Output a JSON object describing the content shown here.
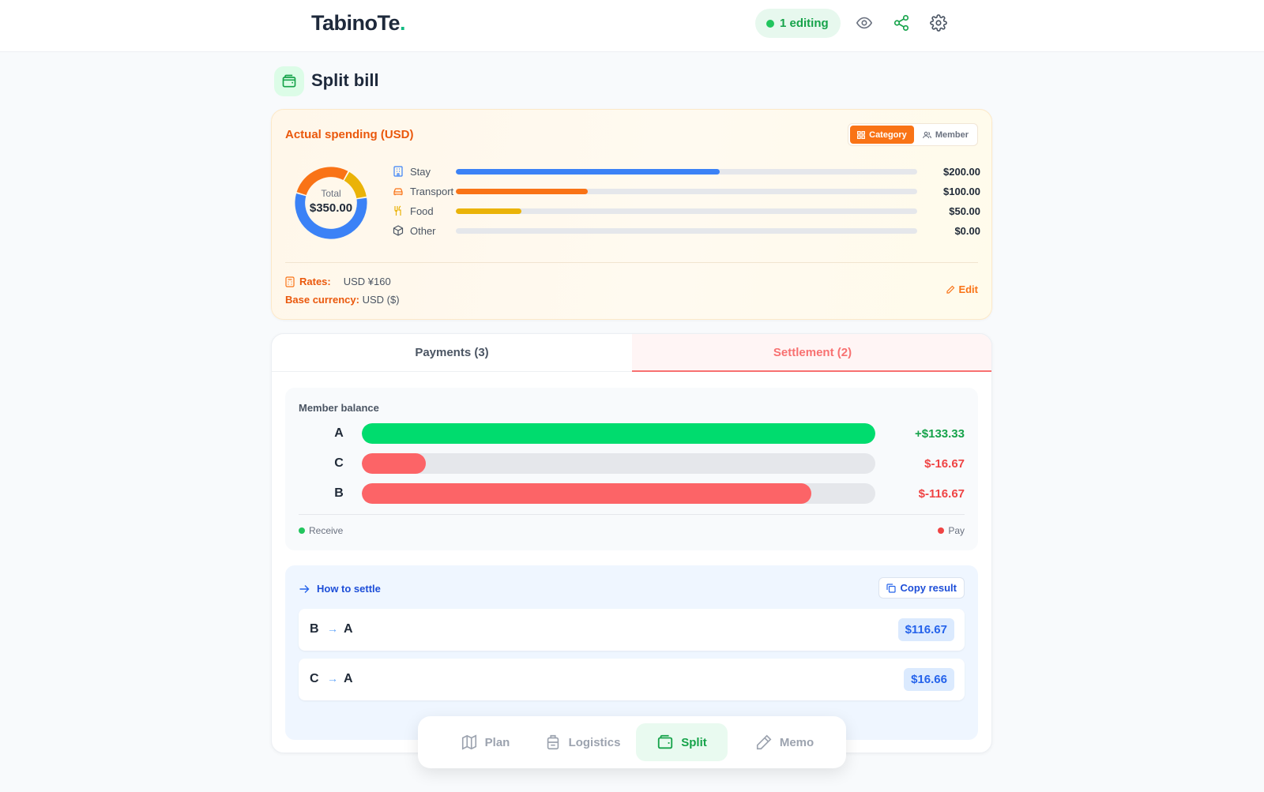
{
  "header": {
    "logo_text": "TabinoTe",
    "logo_dot": ".",
    "editing_label": "1 editing",
    "icons": [
      "eye-icon",
      "share-icon",
      "gear-icon"
    ]
  },
  "page": {
    "title": "Split bill",
    "icon": "wallet-icon"
  },
  "spending": {
    "title": "Actual spending (USD)",
    "toggle": {
      "category_label": "Category",
      "member_label": "Member",
      "selected": "Category"
    },
    "total_label": "Total",
    "total_value": "$350.00",
    "categories": [
      {
        "name": "Stay",
        "amount": "$200.00",
        "value": 200,
        "color": "#3b82f6",
        "icon": "building-icon"
      },
      {
        "name": "Transport",
        "amount": "$100.00",
        "value": 100,
        "color": "#f97316",
        "icon": "car-icon"
      },
      {
        "name": "Food",
        "amount": "$50.00",
        "value": 50,
        "color": "#eab308",
        "icon": "utensils-icon"
      },
      {
        "name": "Other",
        "amount": "$0.00",
        "value": 0,
        "color": "#9ca3af",
        "icon": "box-icon"
      }
    ],
    "rates_label": "Rates:",
    "rates_value": "USD ¥160",
    "base_currency_label": "Base currency:",
    "base_currency_value": "USD ($)",
    "edit_label": "Edit"
  },
  "tabs": {
    "payments_label": "Payments (3)",
    "settlement_label": "Settlement (2)",
    "active": "Settlement (2)"
  },
  "balance": {
    "title": "Member balance",
    "members": [
      {
        "name": "A",
        "amount": "+$133.33",
        "fraction": 1.0,
        "color": "#00dc6e",
        "amount_color": "#16a34a"
      },
      {
        "name": "C",
        "amount": "$-16.67",
        "fraction": 0.125,
        "color": "#fc6467",
        "amount_color": "#ef4444"
      },
      {
        "name": "B",
        "amount": "$-116.67",
        "fraction": 0.875,
        "color": "#fc6467",
        "amount_color": "#ef4444"
      }
    ],
    "legend_receive": "Receive",
    "legend_pay": "Pay",
    "receive_color": "#22c55e",
    "pay_color": "#ef4444"
  },
  "settle": {
    "title": "How to settle",
    "copy_label": "Copy result",
    "transactions": [
      {
        "from": "B",
        "to": "A",
        "amount": "$116.67"
      },
      {
        "from": "C",
        "to": "A",
        "amount": "$16.66"
      }
    ]
  },
  "bottom_nav": {
    "items": [
      {
        "label": "Plan",
        "icon": "map-icon"
      },
      {
        "label": "Logistics",
        "icon": "luggage-icon"
      },
      {
        "label": "Split",
        "icon": "wallet-icon"
      },
      {
        "label": "Memo",
        "icon": "pencil-icon"
      }
    ],
    "active": "Split"
  }
}
